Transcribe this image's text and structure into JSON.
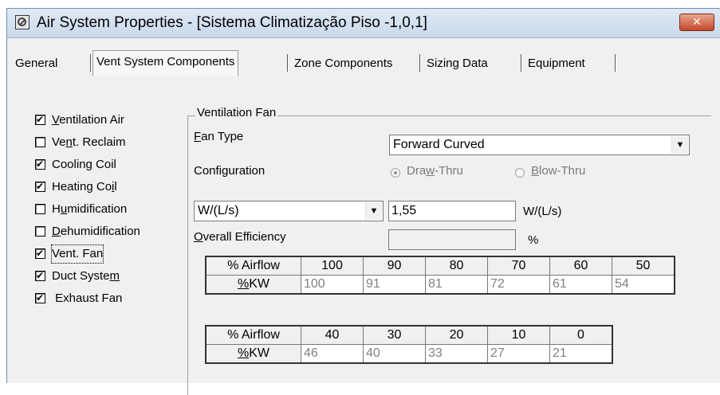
{
  "window": {
    "title": "Air System Properties - [Sistema Climatização Piso -1,0,1]",
    "close_label": "✕"
  },
  "tabs": [
    {
      "label": "General",
      "active": false
    },
    {
      "label": "Vent System Components",
      "active": true
    },
    {
      "label": "Zone Components",
      "active": false
    },
    {
      "label": "Sizing Data",
      "active": false
    },
    {
      "label": "Equipment",
      "active": false
    }
  ],
  "components": [
    {
      "pre": "",
      "key": "V",
      "post": "entilation Air",
      "checked": true
    },
    {
      "pre": "Ve",
      "key": "n",
      "post": "t. Reclaim",
      "checked": false
    },
    {
      "pre": "Cooling Coil",
      "key": "",
      "post": "",
      "checked": true
    },
    {
      "pre": "Heating Co",
      "key": "i",
      "post": "l",
      "checked": true
    },
    {
      "pre": "H",
      "key": "u",
      "post": "midification",
      "checked": false
    },
    {
      "pre": "",
      "key": "D",
      "post": "ehumidification",
      "checked": false
    },
    {
      "pre": "Vent. Fan",
      "key": "",
      "post": "",
      "checked": true
    },
    {
      "pre": "Duct Syste",
      "key": "m",
      "post": "",
      "checked": true
    },
    {
      "pre": " Exhaust Fan",
      "key": "",
      "post": "",
      "checked": true
    }
  ],
  "fan": {
    "group_title": "Ventilation Fan",
    "type_label_key": "F",
    "type_label_rest": "an Type",
    "type_value": "Forward Curved",
    "config_label": "Configuration",
    "draw_thru_pre": "Dra",
    "draw_thru_key": "w",
    "draw_thru_post": "-Thru",
    "blow_thru_key": "B",
    "blow_thru_post": "low-Thru",
    "draw_thru_selected": true,
    "unit_select": "W/(L/s)",
    "unit_value": "1,55",
    "unit_label": "W/(L/s)",
    "efficiency_key": "O",
    "efficiency_rest": "verall Efficiency",
    "efficiency_value": "",
    "efficiency_unit": "%"
  },
  "table1": {
    "airflow_label": "% Airflow",
    "kw_label_key": "%",
    "kw_label_rest": "KW",
    "airflow": [
      "100",
      "90",
      "80",
      "70",
      "60",
      "50"
    ],
    "kw": [
      "100",
      "91",
      "81",
      "72",
      "61",
      "54"
    ]
  },
  "table2": {
    "airflow_label": "% Airflow",
    "kw_label_key": "%",
    "kw_label_rest": "KW",
    "airflow": [
      "40",
      "30",
      "20",
      "10",
      "0"
    ],
    "kw": [
      "46",
      "40",
      "33",
      "27",
      "21"
    ]
  }
}
